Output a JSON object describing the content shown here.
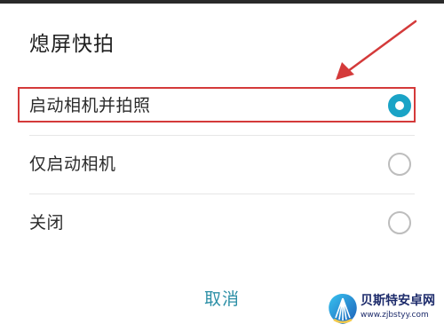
{
  "dialog": {
    "title": "熄屏快拍",
    "options": [
      {
        "label": "启动相机并拍照",
        "selected": true
      },
      {
        "label": "仅启动相机",
        "selected": false
      },
      {
        "label": "关闭",
        "selected": false
      }
    ],
    "cancel_label": "取消"
  },
  "colors": {
    "accent": "#1aa3c6",
    "annotation_red": "#d43a3a",
    "cancel_text": "#2c8fa6"
  },
  "watermark": {
    "name": "贝斯特安卓网",
    "url": "www.zjbstyy.com"
  }
}
